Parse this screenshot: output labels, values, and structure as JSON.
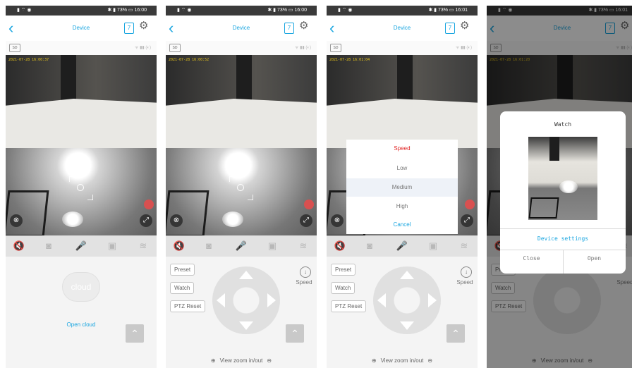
{
  "status": {
    "left": "▮ ⌔ ◉",
    "right": [
      "✱ ▮ 73% ▭ 16:00",
      "✱ ▮ 73% ▭ 16:00",
      "✱ ▮ 73% ▭ 16:01",
      "✱ ▮ 73% ▭ 16:01"
    ]
  },
  "nav": {
    "back": "‹",
    "title": "Device",
    "calendar": "7",
    "settings_icon": "gear-icon"
  },
  "info": {
    "sd": "SD",
    "signal": "ᯤ ▮▮ (◐)"
  },
  "video": {
    "timestamps": [
      "2021-07-28 16:00:37",
      "2021-07-28 16:00:52",
      "2021-07-28 16:01:04",
      "2021-07-28 16:01:20"
    ]
  },
  "toolbar": {
    "icons": [
      "mute-icon",
      "camera-icon",
      "mic-icon",
      "record-icon",
      "fullscreen-icon"
    ]
  },
  "panel1": {
    "open_cloud": "Open cloud",
    "cloud_text": "cloud"
  },
  "ptz": {
    "preset": "Preset",
    "watch": "Watch",
    "ptz_reset": "PTZ Reset",
    "speed": "Speed",
    "zoom_label": "View zoom in/out"
  },
  "speed_sheet": {
    "title": "Speed",
    "low": "Low",
    "medium": "Medium",
    "high": "High",
    "cancel": "Cancel"
  },
  "watch_dialog": {
    "title": "Watch",
    "settings": "Device settings",
    "close": "Close",
    "open": "Open"
  },
  "colors": {
    "accent": "#1aa6e0",
    "red": "#e02424"
  }
}
